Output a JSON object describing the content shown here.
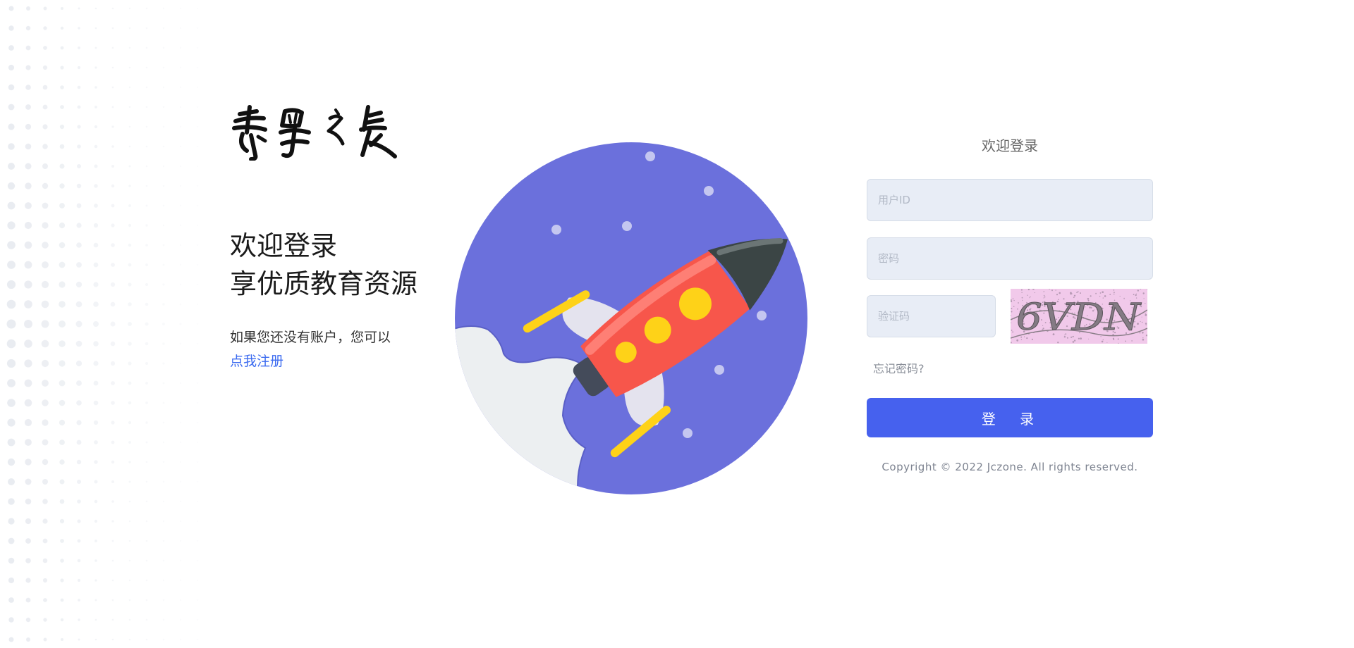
{
  "brand": {
    "logo_text": "景星之长"
  },
  "hero": {
    "title_line1": "欢迎登录",
    "title_line2": "享优质教育资源",
    "subtitle": "如果您还没有账户，您可以",
    "register_link": "点我注册"
  },
  "login": {
    "title": "欢迎登录",
    "user_id_placeholder": "用户ID",
    "password_placeholder": "密码",
    "captcha_placeholder": "验证码",
    "captcha_text": "6VDN",
    "forgot_label": "忘记密码?",
    "submit_label": "登 录"
  },
  "footer": {
    "copyright": "Copyright © 2022 Jczone. All rights reserved."
  },
  "colors": {
    "accent": "#4661ee",
    "link": "#3d6cf0",
    "planet": "#6b70dc",
    "rocket_body": "#f7564b",
    "rocket_nose": "#3b4545",
    "portholes": "#fed218",
    "fins": "#e4e3ee"
  }
}
